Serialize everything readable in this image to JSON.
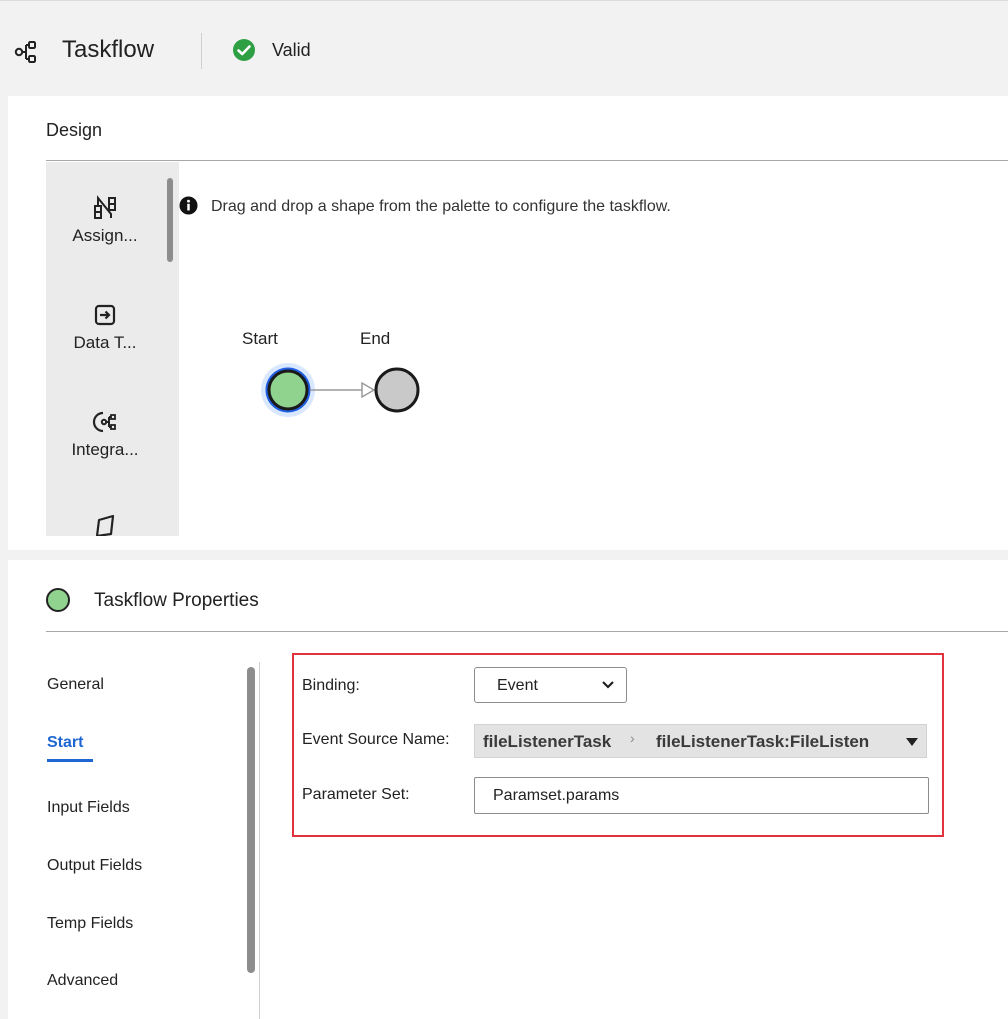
{
  "header": {
    "title": "Taskflow",
    "status": "Valid",
    "status_color": "#2ea043"
  },
  "design": {
    "title": "Design",
    "hint": "Drag and drop a shape from the palette to configure the taskflow.",
    "palette": [
      {
        "label": "Assign...",
        "icon": "assignment-icon"
      },
      {
        "label": "Data T...",
        "icon": "data-task-icon"
      },
      {
        "label": "Integra...",
        "icon": "integration-icon"
      },
      {
        "label": "",
        "icon": "notification-icon"
      }
    ],
    "nodes": {
      "start_label": "Start",
      "end_label": "End",
      "start_color": "#90d38e",
      "end_color": "#c9c9c9"
    }
  },
  "properties": {
    "title": "Taskflow Properties",
    "tabs": [
      "General",
      "Start",
      "Input Fields",
      "Output Fields",
      "Temp Fields",
      "Advanced"
    ],
    "active_tab": "Start",
    "binding": {
      "label": "Binding:",
      "value": "Event"
    },
    "event_source": {
      "label": "Event Source Name:",
      "path": [
        "fileListenerTask",
        "fileListenerTask:FileListen"
      ]
    },
    "parameter_set": {
      "label": "Parameter Set:",
      "value": "Paramset.params"
    },
    "highlight_color": "#e0333d",
    "accent_color": "#1e67d2"
  }
}
